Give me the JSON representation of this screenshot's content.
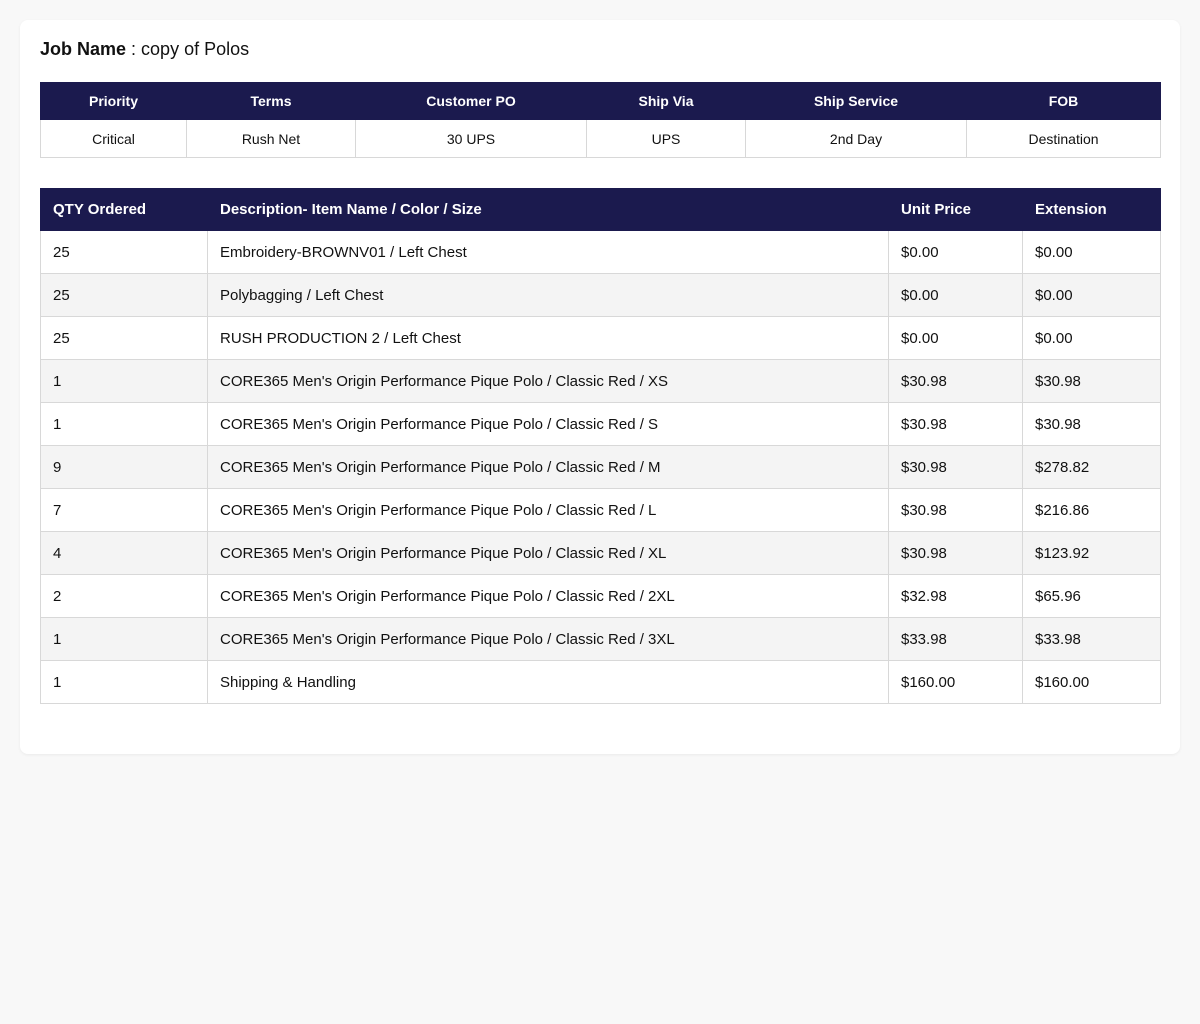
{
  "job": {
    "label": "Job Name",
    "separator": " : ",
    "value": "copy of Polos"
  },
  "summary": {
    "headers": [
      "Priority",
      "Terms",
      "Customer PO",
      "Ship Via",
      "Ship Service",
      "FOB"
    ],
    "values": [
      "Critical",
      "Rush Net",
      "30 UPS",
      "UPS",
      "2nd Day",
      "Destination"
    ]
  },
  "items": {
    "headers": [
      "QTY Ordered",
      "Description- Item Name / Color / Size",
      "Unit Price",
      "Extension"
    ],
    "rows": [
      {
        "qty": "25",
        "description": "Embroidery-BROWNV01 / Left Chest",
        "unit_price": "$0.00",
        "extension": "$0.00"
      },
      {
        "qty": "25",
        "description": "Polybagging / Left Chest",
        "unit_price": "$0.00",
        "extension": "$0.00"
      },
      {
        "qty": "25",
        "description": "RUSH PRODUCTION 2 / Left Chest",
        "unit_price": "$0.00",
        "extension": "$0.00"
      },
      {
        "qty": "1",
        "description": "CORE365 Men's Origin Performance Pique Polo / Classic Red / XS",
        "unit_price": "$30.98",
        "extension": "$30.98"
      },
      {
        "qty": "1",
        "description": "CORE365 Men's Origin Performance Pique Polo / Classic Red / S",
        "unit_price": "$30.98",
        "extension": "$30.98"
      },
      {
        "qty": "9",
        "description": "CORE365 Men's Origin Performance Pique Polo / Classic Red / M",
        "unit_price": "$30.98",
        "extension": "$278.82"
      },
      {
        "qty": "7",
        "description": "CORE365 Men's Origin Performance Pique Polo / Classic Red / L",
        "unit_price": "$30.98",
        "extension": "$216.86"
      },
      {
        "qty": "4",
        "description": "CORE365 Men's Origin Performance Pique Polo / Classic Red / XL",
        "unit_price": "$30.98",
        "extension": "$123.92"
      },
      {
        "qty": "2",
        "description": "CORE365 Men's Origin Performance Pique Polo / Classic Red / 2XL",
        "unit_price": "$32.98",
        "extension": "$65.96"
      },
      {
        "qty": "1",
        "description": "CORE365 Men's Origin Performance Pique Polo / Classic Red / 3XL",
        "unit_price": "$33.98",
        "extension": "$33.98"
      },
      {
        "qty": "1",
        "description": "Shipping & Handling",
        "unit_price": "$160.00",
        "extension": "$160.00"
      }
    ]
  },
  "colors": {
    "header_bg": "#1b1a4e",
    "header_text": "#ffffff",
    "row_alt_bg": "#f4f4f4",
    "border": "#d8d8d8",
    "page_bg": "#f8f8f8"
  }
}
